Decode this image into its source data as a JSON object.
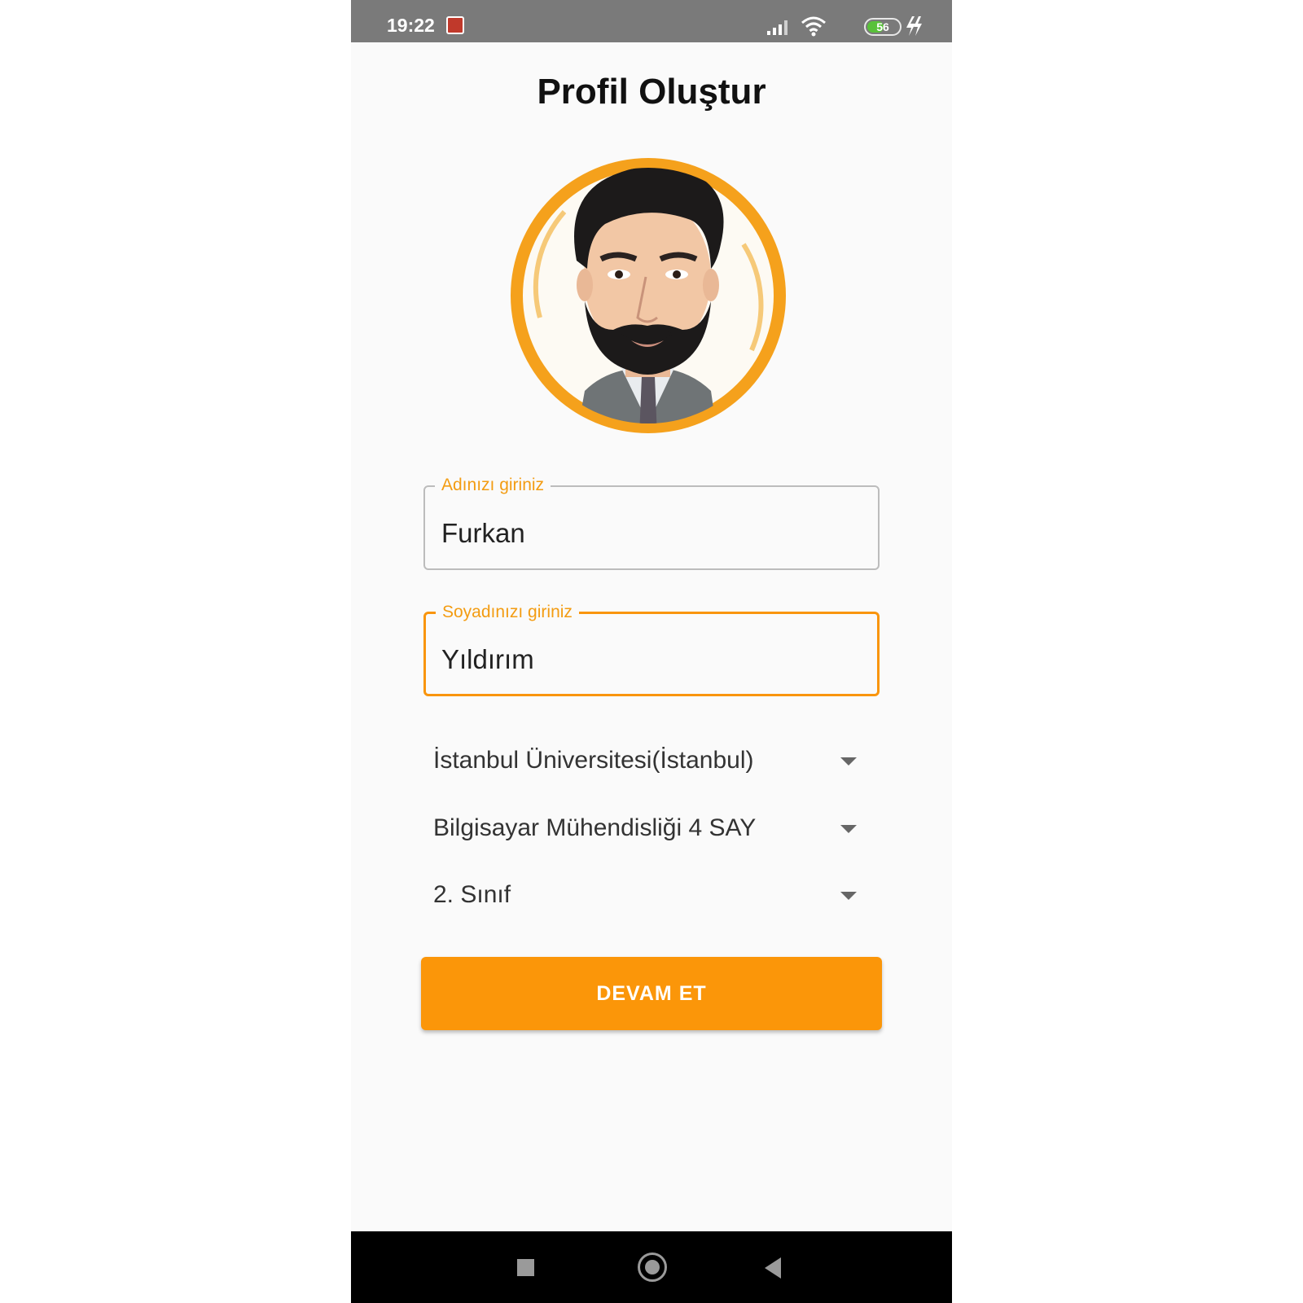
{
  "status_bar": {
    "time": "19:22",
    "battery_percent": "56",
    "battery_level": 0.56,
    "icons": [
      "notification-icon",
      "signal-icon",
      "wifi-icon",
      "battery-icon",
      "charging-icon"
    ]
  },
  "header": {
    "title": "Profil Oluştur"
  },
  "avatar": {
    "icon": "avatar-icon",
    "ring_color": "#f5a11c"
  },
  "form": {
    "first_name": {
      "label": "Adınızı giriniz",
      "value": "Furkan"
    },
    "last_name": {
      "label": "Soyadınızı giriniz",
      "value": "Yıldırım"
    },
    "university": {
      "value": "İstanbul Üniversitesi(İstanbul)"
    },
    "department": {
      "value": "Bilgisayar Mühendisliği 4 SAY"
    },
    "grade": {
      "value": "2. Sınıf"
    },
    "submit_label": "DEVAM ET"
  },
  "nav_bar": {
    "icons": [
      "recents-icon",
      "home-icon",
      "back-icon"
    ]
  },
  "colors": {
    "accent": "#fb9609",
    "label": "#f39c12",
    "status_bar": "#7a7a7a",
    "nav_bar": "#000000",
    "background": "#fafafa"
  }
}
